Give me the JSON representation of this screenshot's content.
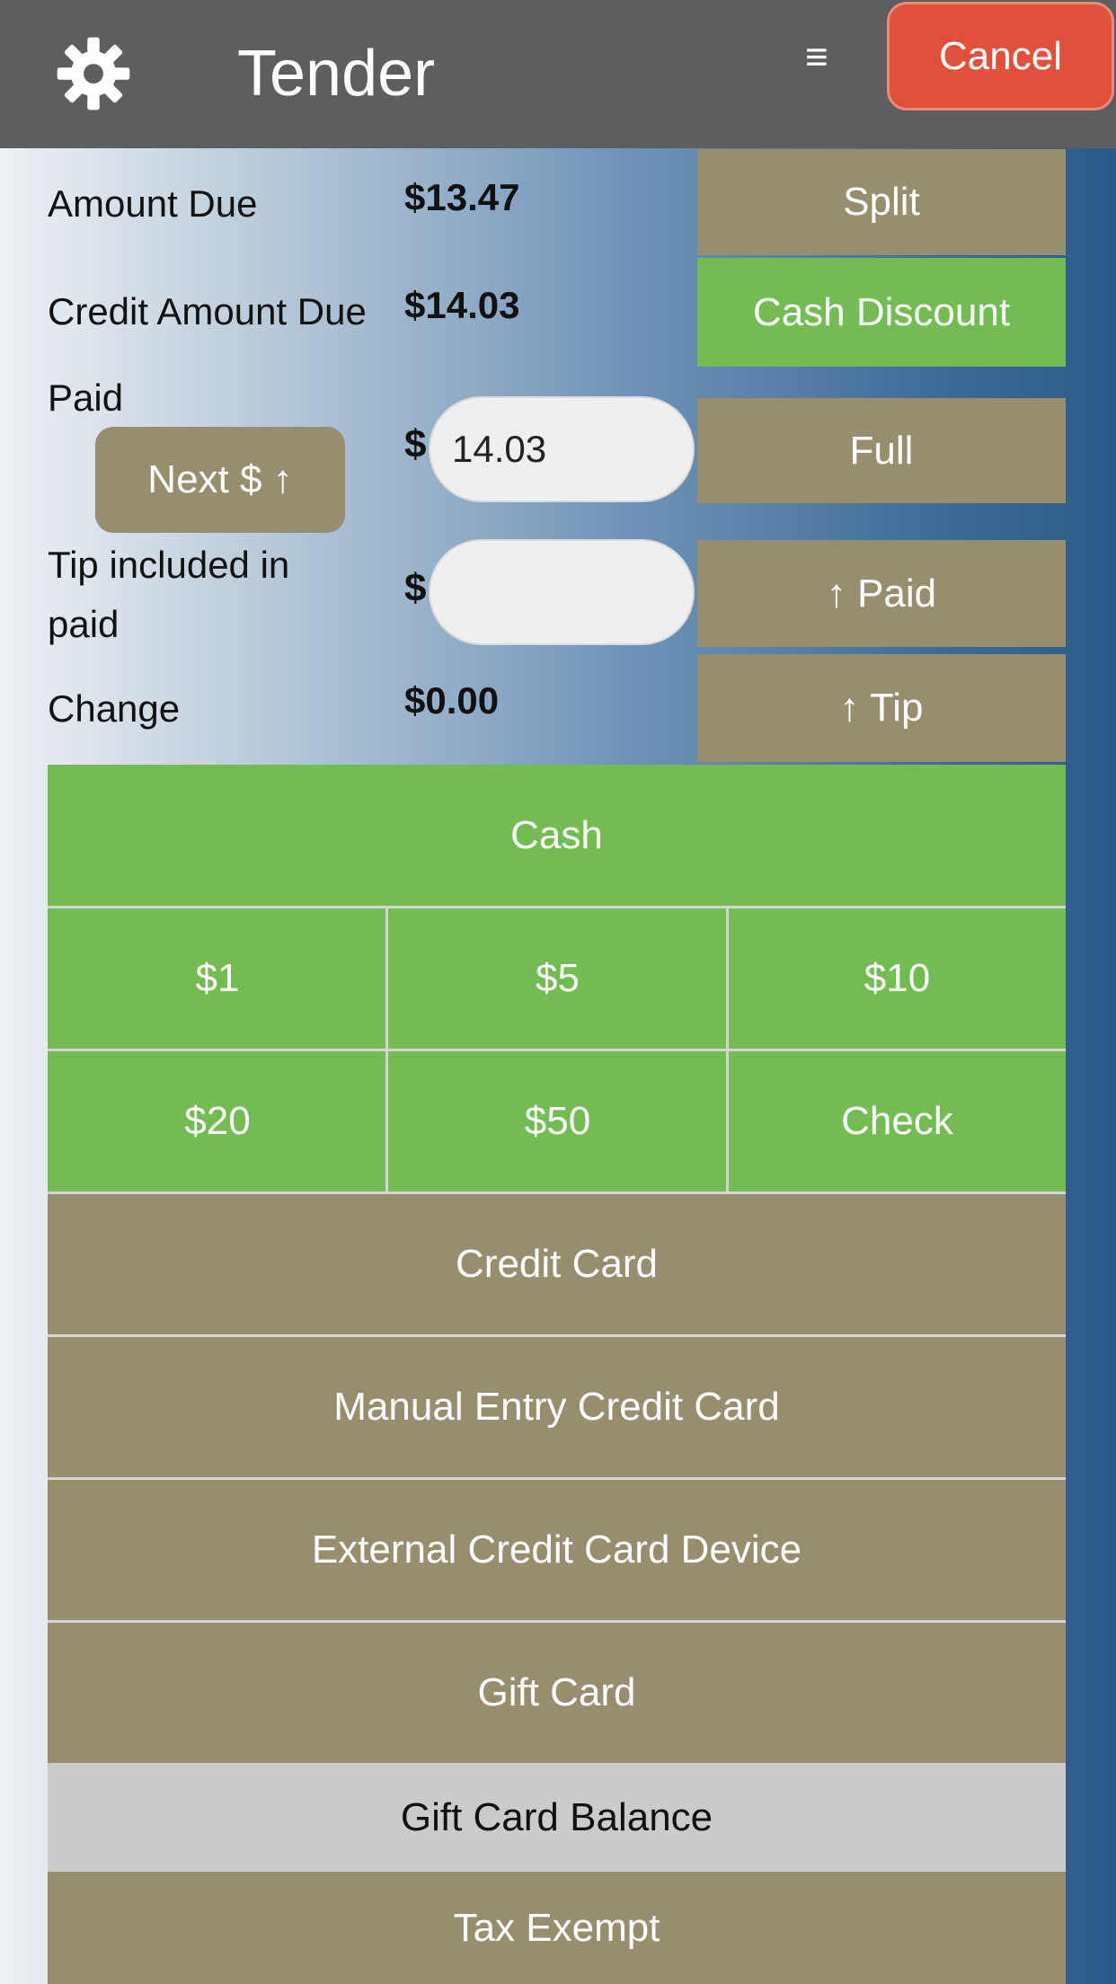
{
  "header": {
    "title": "Tender",
    "menu_icon": "≡",
    "cancel_label": "Cancel"
  },
  "summary": {
    "amount_due_label": "Amount Due",
    "amount_due_value": "$13.47",
    "credit_due_label": "Credit Amount Due",
    "credit_due_value": "$14.03",
    "paid_label": "Paid",
    "paid_currency": "$",
    "paid_value": "14.03",
    "next_label": "Next $ ↑",
    "tip_label_line1": "Tip included in",
    "tip_label_line2": "paid",
    "tip_currency": "$",
    "tip_value": "",
    "change_label": "Change",
    "change_value": "$0.00"
  },
  "side_buttons": {
    "split": "Split",
    "cash_discount": "Cash Discount",
    "full": "Full",
    "paid_up": "↑ Paid",
    "tip_up": "↑ Tip"
  },
  "tender": {
    "cash": "Cash",
    "d1": "$1",
    "d5": "$5",
    "d10": "$10",
    "d20": "$20",
    "d50": "$50",
    "check": "Check",
    "credit_card": "Credit Card",
    "manual_credit": "Manual Entry Credit Card",
    "external_credit": "External Credit Card Device",
    "gift_card": "Gift Card",
    "gift_balance": "Gift Card Balance",
    "tax_exempt": "Tax Exempt"
  },
  "colors": {
    "header_bg": "#5e5e5e",
    "cancel_bg": "#e0503d",
    "tan": "#978e6f",
    "green": "#73bc54",
    "grey": "#cbcbcb"
  }
}
